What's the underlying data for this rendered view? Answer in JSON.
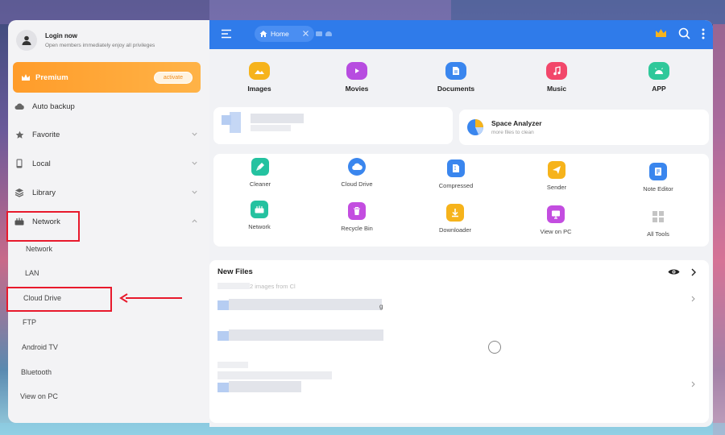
{
  "sidebar": {
    "login": {
      "title": "Login now",
      "subtitle": "Open members immediately enjoy all privileges"
    },
    "premium": {
      "label": "Premium",
      "button": "activate"
    },
    "items": [
      {
        "label": "Auto backup",
        "icon": "cloud-icon"
      },
      {
        "label": "Favorite",
        "icon": "star-icon"
      },
      {
        "label": "Local",
        "icon": "phone-icon"
      },
      {
        "label": "Library",
        "icon": "stack-icon"
      },
      {
        "label": "Network",
        "icon": "network-icon"
      }
    ],
    "network_sub": [
      "Network",
      "LAN",
      "Cloud Drive",
      "FTP",
      "Android TV",
      "Bluetooth",
      "View on PC"
    ]
  },
  "topbar": {
    "tab_label": "Home"
  },
  "categories": [
    {
      "label": "Images",
      "color": "#f6b31b"
    },
    {
      "label": "Movies",
      "color": "#b74ce0"
    },
    {
      "label": "Documents",
      "color": "#3a86ee"
    },
    {
      "label": "Music",
      "color": "#f2476a"
    },
    {
      "label": "APP",
      "color": "#2fc89a"
    }
  ],
  "space_analyzer": {
    "title": "Space Analyzer",
    "subtitle": "more files to clean"
  },
  "tools": [
    {
      "label": "Cleaner",
      "color": "#24c2a0"
    },
    {
      "label": "Cloud Drive",
      "color": "#3a86ee"
    },
    {
      "label": "Compressed",
      "color": "#3a86ee"
    },
    {
      "label": "Sender",
      "color": "#f6b31b"
    },
    {
      "label": "Note Editor",
      "color": "#3a86ee"
    },
    {
      "label": "Network",
      "color": "#24c2a0"
    },
    {
      "label": "Recycle Bin",
      "color": "#c34de0"
    },
    {
      "label": "Downloader",
      "color": "#f6b31b"
    },
    {
      "label": "View on PC",
      "color": "#c34de0"
    },
    {
      "label": "All Tools",
      "color": "#b8b8b8"
    }
  ],
  "new_files": {
    "title": "New Files",
    "row1_text": "2 images from Cl"
  }
}
